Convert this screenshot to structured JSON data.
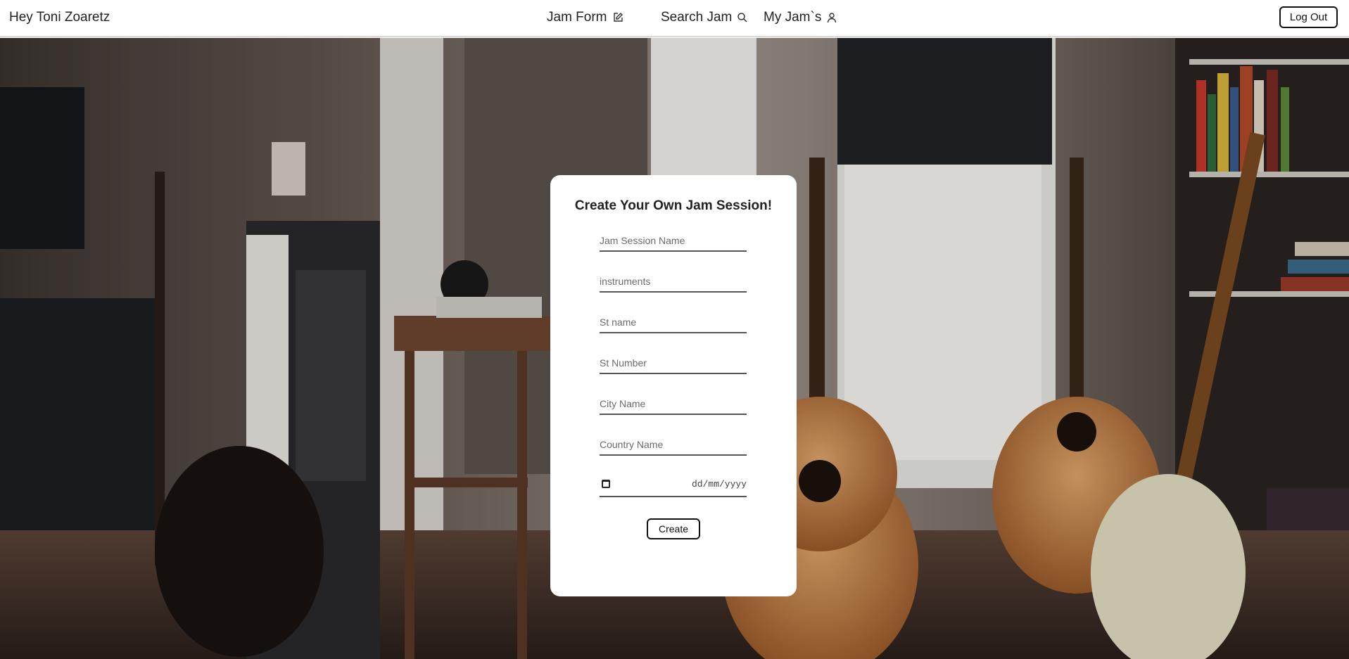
{
  "header": {
    "greeting": "Hey Toni Zoaretz",
    "nav": [
      {
        "label": "Jam Form",
        "icon": "edit-icon"
      },
      {
        "label": "Search Jam",
        "icon": "search-icon"
      },
      {
        "label": "My Jam`s",
        "icon": "user-icon"
      }
    ],
    "logout_label": "Log Out"
  },
  "form": {
    "title": "Create Your Own Jam Session!",
    "fields": [
      {
        "placeholder": "Jam Session Name",
        "value": ""
      },
      {
        "placeholder": "instruments",
        "value": ""
      },
      {
        "placeholder": "St name",
        "value": ""
      },
      {
        "placeholder": "St Number",
        "value": ""
      },
      {
        "placeholder": "City Name",
        "value": ""
      },
      {
        "placeholder": "Country Name",
        "value": ""
      }
    ],
    "date_placeholder": "dd/mm/yyyy",
    "submit_label": "Create"
  },
  "colors": {
    "card_background": "#ffffff",
    "text": "#222222",
    "border": "#111111"
  }
}
